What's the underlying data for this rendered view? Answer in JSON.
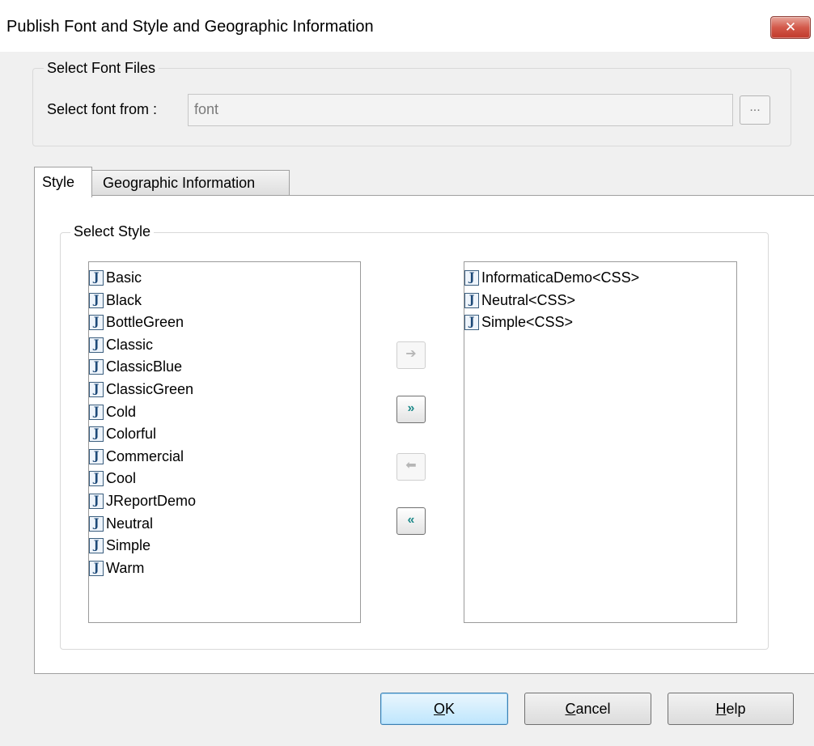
{
  "window": {
    "title": "Publish Font and Style and Geographic Information",
    "close_glyph": "✕"
  },
  "font_files": {
    "group_label": "Select Font Files",
    "label": "Select font from :",
    "value": "font",
    "browse_label": "..."
  },
  "tabs": [
    {
      "label": "Style",
      "selected": true
    },
    {
      "label": "Geographic Information",
      "selected": false
    }
  ],
  "style_panel": {
    "group_label": "Select Style",
    "available": [
      "Basic",
      "Black",
      "BottleGreen",
      "Classic",
      "ClassicBlue",
      "ClassicGreen",
      "Cold",
      "Colorful",
      "Commercial",
      "Cool",
      "JReportDemo",
      "Neutral",
      "Simple",
      "Warm"
    ],
    "selected": [
      "InformaticaDemo<CSS>",
      "Neutral<CSS>",
      "Simple<CSS>"
    ],
    "item_icon": "style-file-icon",
    "item_icon_glyph": "J",
    "move_buttons": [
      {
        "name": "add-right-button",
        "glyph": "➔",
        "enabled": false
      },
      {
        "name": "add-all-right-button",
        "glyph": "»",
        "enabled": true
      },
      {
        "name": "remove-left-button",
        "glyph": "⬅",
        "enabled": false
      },
      {
        "name": "remove-all-left-button",
        "glyph": "«",
        "enabled": true
      }
    ]
  },
  "footer": {
    "ok": {
      "mnemonic": "O",
      "rest": "K"
    },
    "cancel": {
      "mnemonic": "C",
      "rest": "ancel"
    },
    "help": {
      "mnemonic": "H",
      "rest": "elp"
    }
  }
}
